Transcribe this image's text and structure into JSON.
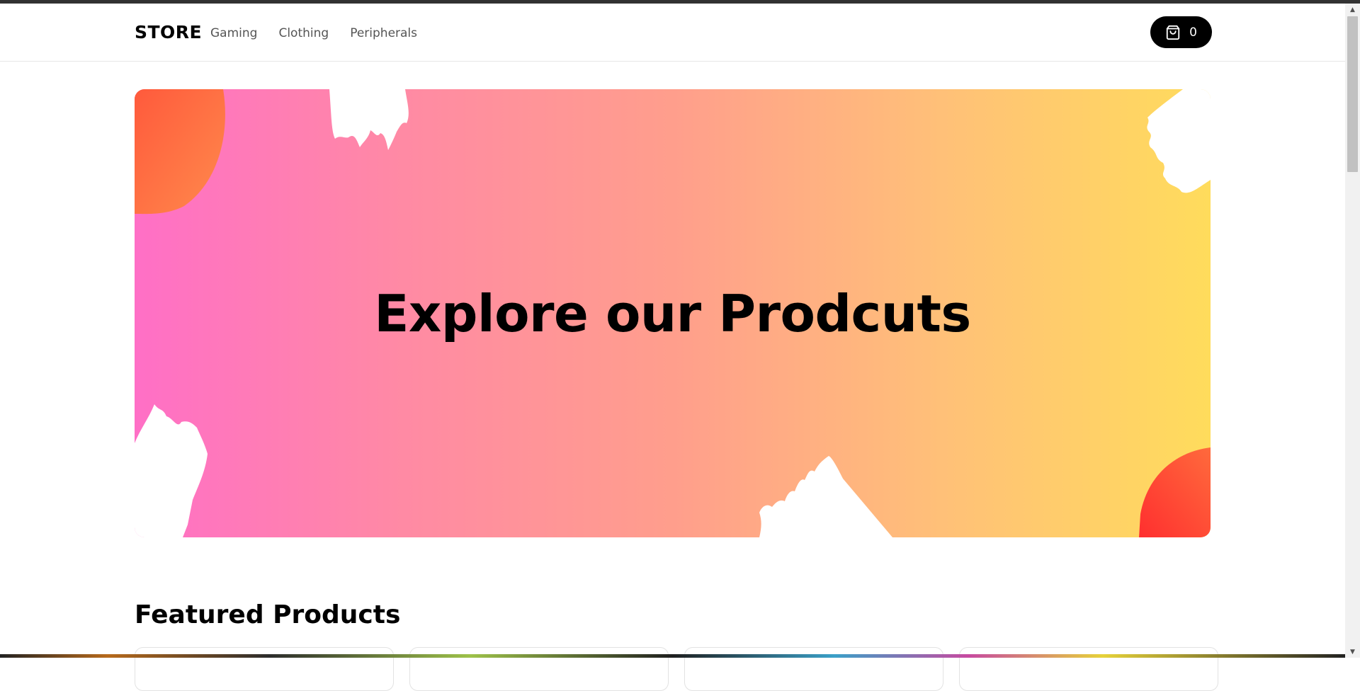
{
  "nav": {
    "brand": "STORE",
    "links": [
      "Gaming",
      "Clothing",
      "Peripherals"
    ],
    "cart": {
      "icon": "shopping-bag-icon",
      "count": "0"
    }
  },
  "hero": {
    "title": "Explore our Prodcuts",
    "gradient": [
      "#ff6fc6",
      "#ff9e8c",
      "#ffdc5c"
    ]
  },
  "featured": {
    "title": "Featured Products"
  }
}
